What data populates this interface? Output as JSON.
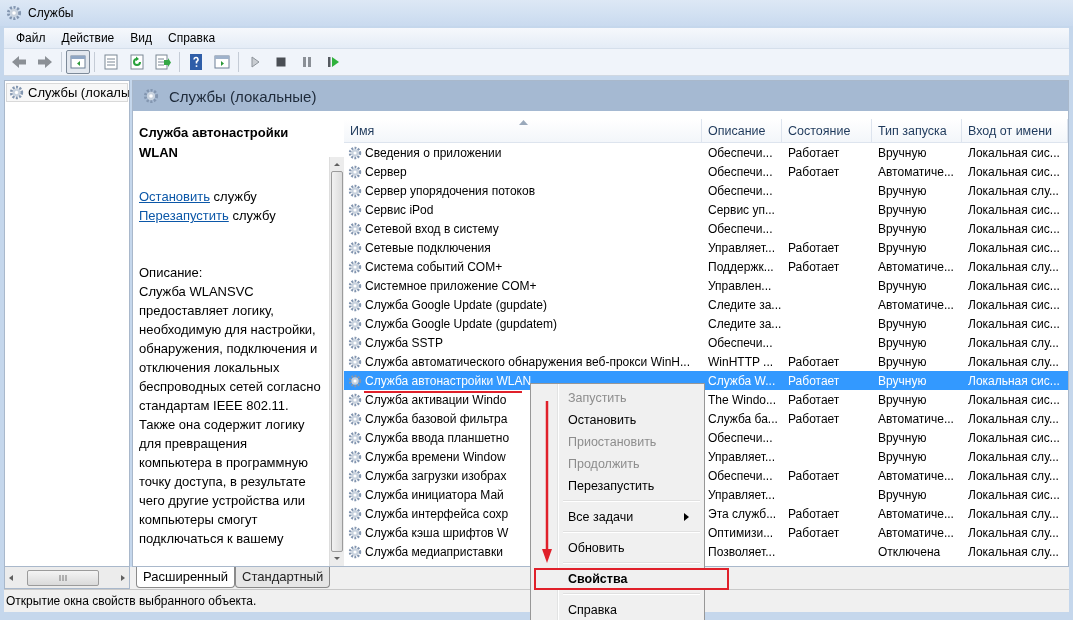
{
  "window": {
    "title": "Службы"
  },
  "menu_bar": [
    {
      "label": "Файл"
    },
    {
      "label": "Действие"
    },
    {
      "label": "Вид"
    },
    {
      "label": "Справка"
    }
  ],
  "tree": {
    "items": [
      {
        "label": "Службы (локалы",
        "selected": true
      }
    ]
  },
  "pane_header": {
    "title": "Службы (локальные)"
  },
  "details": {
    "title": "Служба автонастройки WLAN",
    "actions": [
      {
        "link": "Остановить",
        "text": "службу"
      },
      {
        "link": "Перезапустить",
        "text": "службу"
      }
    ],
    "description_label": "Описание:",
    "description": "Служба WLANSVC предоставляет логику, необходимую для настройки, обнаружения, подключения и отключения локальных беспроводных сетей согласно стандартам IEEE 802.11. Также она содержит логику для превращения компьютера в программную точку доступа, в результате чего другие устройства или компьютеры смогут подключаться к вашему"
  },
  "table": {
    "columns": [
      {
        "label": "Имя",
        "sorted": true
      },
      {
        "label": "Описание",
        "sorted": false
      },
      {
        "label": "Состояние",
        "sorted": false
      },
      {
        "label": "Тип запуска",
        "sorted": false
      },
      {
        "label": "Вход от имени",
        "sorted": false
      }
    ],
    "rows": [
      {
        "name": "Сведения о приложении",
        "description": "Обеспечи...",
        "status": "Работает",
        "startup": "Вручную",
        "logon": "Локальная сис...",
        "selected": false
      },
      {
        "name": "Сервер",
        "description": "Обеспечи...",
        "status": "Работает",
        "startup": "Автоматиче...",
        "logon": "Локальная сис...",
        "selected": false
      },
      {
        "name": "Сервер упорядочения потоков",
        "description": "Обеспечи...",
        "startup": "Вручную",
        "logon": "Локальная слу...",
        "selected": false
      },
      {
        "name": "Сервис iPod",
        "description": "Сервис уп...",
        "startup": "Вручную",
        "logon": "Локальная сис...",
        "selected": false
      },
      {
        "name": "Сетевой вход в систему",
        "description": "Обеспечи...",
        "startup": "Вручную",
        "logon": "Локальная сис...",
        "selected": false
      },
      {
        "name": "Сетевые подключения",
        "description": "Управляет...",
        "status": "Работает",
        "startup": "Вручную",
        "logon": "Локальная сис...",
        "selected": false
      },
      {
        "name": "Система событий COM+",
        "description": "Поддержк...",
        "status": "Работает",
        "startup": "Автоматиче...",
        "logon": "Локальная слу...",
        "selected": false
      },
      {
        "name": "Системное приложение COM+",
        "description": "Управлен...",
        "startup": "Вручную",
        "logon": "Локальная сис...",
        "selected": false
      },
      {
        "name": "Служба Google Update (gupdate)",
        "description": "Следите за...",
        "startup": "Автоматиче...",
        "logon": "Локальная сис...",
        "selected": false
      },
      {
        "name": "Служба Google Update (gupdatem)",
        "description": "Следите за...",
        "startup": "Вручную",
        "logon": "Локальная сис...",
        "selected": false
      },
      {
        "name": "Служба SSTP",
        "description": "Обеспечи...",
        "startup": "Вручную",
        "logon": "Локальная слу...",
        "selected": false
      },
      {
        "name": "Служба автоматического обнаружения веб-прокси WinH...",
        "description": "WinHTTP ...",
        "status": "Работает",
        "startup": "Вручную",
        "logon": "Локальная слу...",
        "selected": false
      },
      {
        "name": "Служба автонастройки WLAN",
        "description": "Служба W...",
        "status": "Работает",
        "startup": "Вручную",
        "logon": "Локальная сис...",
        "selected": true,
        "underlined": true
      },
      {
        "name": "Служба активации Windo",
        "description": "The Windo...",
        "status": "Работает",
        "startup": "Вручную",
        "logon": "Локальная сис...",
        "selected": false
      },
      {
        "name": "Служба базовой фильтра",
        "description": "Служба ба...",
        "status": "Работает",
        "startup": "Автоматиче...",
        "logon": "Локальная слу...",
        "selected": false
      },
      {
        "name": "Служба ввода планшетно",
        "description": "Обеспечи...",
        "startup": "Вручную",
        "logon": "Локальная сис...",
        "selected": false
      },
      {
        "name": "Служба времени Window",
        "description": "Управляет...",
        "startup": "Вручную",
        "logon": "Локальная слу...",
        "selected": false
      },
      {
        "name": "Служба загрузки изобрах",
        "description": "Обеспечи...",
        "status": "Работает",
        "startup": "Автоматиче...",
        "logon": "Локальная слу...",
        "selected": false
      },
      {
        "name": "Служба инициатора Май",
        "description": "Управляет...",
        "startup": "Вручную",
        "logon": "Локальная сис...",
        "selected": false
      },
      {
        "name": "Служба интерфейса сохр",
        "description": "Эта служб...",
        "status": "Работает",
        "startup": "Автоматиче...",
        "logon": "Локальная слу...",
        "selected": false
      },
      {
        "name": "Служба кэша шрифтов W",
        "description": "Оптимизи...",
        "status": "Работает",
        "startup": "Автоматиче...",
        "logon": "Локальная слу...",
        "selected": false
      },
      {
        "name": "Служба медиаприставки",
        "description": "Позволяет...",
        "startup": "Отключена",
        "logon": "Локальная слу...",
        "selected": false
      }
    ]
  },
  "view_tabs": [
    {
      "label": "Расширенный",
      "selected": true
    },
    {
      "label": "Стандартный",
      "selected": false
    }
  ],
  "context_menu": {
    "arrow": true,
    "items": [
      {
        "kind": "item",
        "label": "Запустить",
        "disabled": true
      },
      {
        "kind": "item",
        "label": "Остановить",
        "disabled": false
      },
      {
        "kind": "item",
        "label": "Приостановить",
        "disabled": true
      },
      {
        "kind": "item",
        "label": "Продолжить",
        "disabled": true
      },
      {
        "kind": "item",
        "label": "Перезапустить",
        "disabled": false
      },
      {
        "kind": "separator"
      },
      {
        "kind": "submenu",
        "label": "Все задачи",
        "disabled": false
      },
      {
        "kind": "separator"
      },
      {
        "kind": "item",
        "label": "Обновить",
        "disabled": false
      },
      {
        "kind": "separator"
      },
      {
        "kind": "item",
        "label": "Свойства",
        "disabled": false,
        "default": true,
        "highlighted": true
      },
      {
        "kind": "separator"
      },
      {
        "kind": "item",
        "label": "Справка",
        "disabled": false
      }
    ]
  },
  "status_bar": {
    "text": "Открытие окна свойств выбранного объекта."
  }
}
